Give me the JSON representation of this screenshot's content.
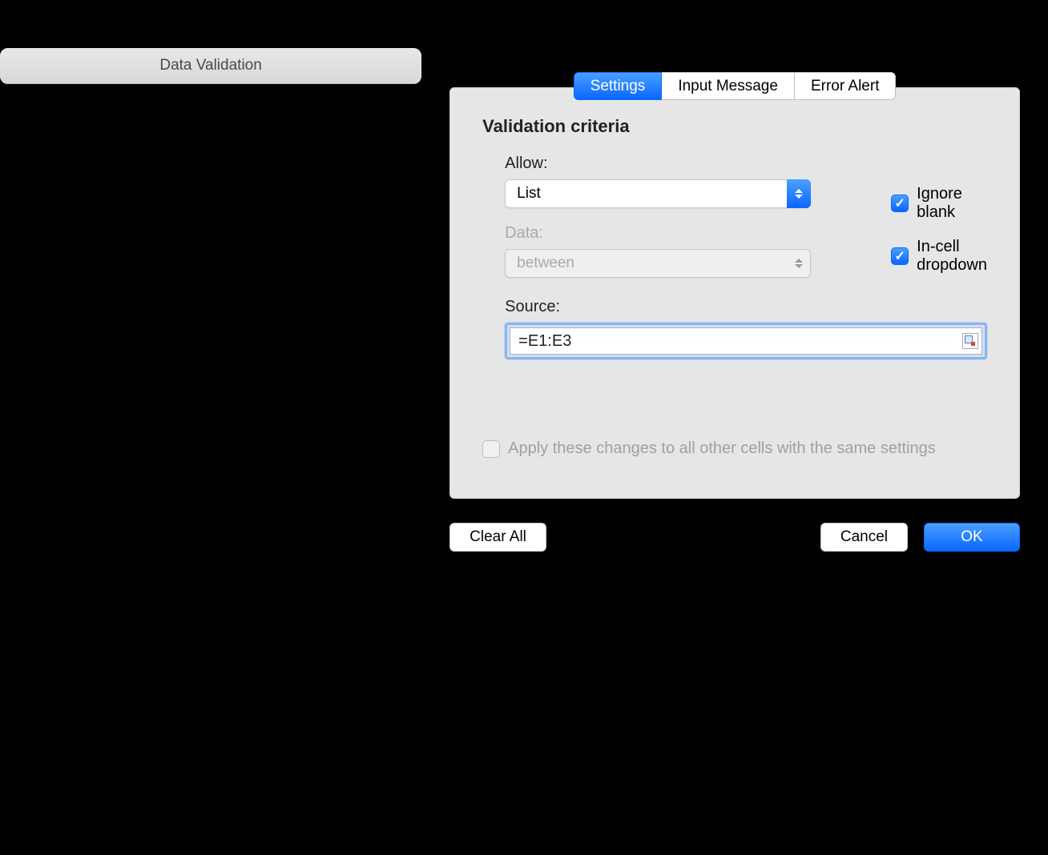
{
  "dialog": {
    "title": "Data Validation"
  },
  "tabs": {
    "settings": "Settings",
    "input_message": "Input Message",
    "error_alert": "Error Alert"
  },
  "panel": {
    "section_title": "Validation criteria",
    "allow_label": "Allow:",
    "allow_value": "List",
    "data_label": "Data:",
    "data_value": "between",
    "source_label": "Source:",
    "source_value": "=E1:E3",
    "ignore_blank": "Ignore blank",
    "in_cell_dropdown": "In-cell dropdown",
    "apply_same": "Apply these changes to all other cells with the same settings"
  },
  "footer": {
    "clear_all": "Clear All",
    "cancel": "Cancel",
    "ok": "OK"
  }
}
